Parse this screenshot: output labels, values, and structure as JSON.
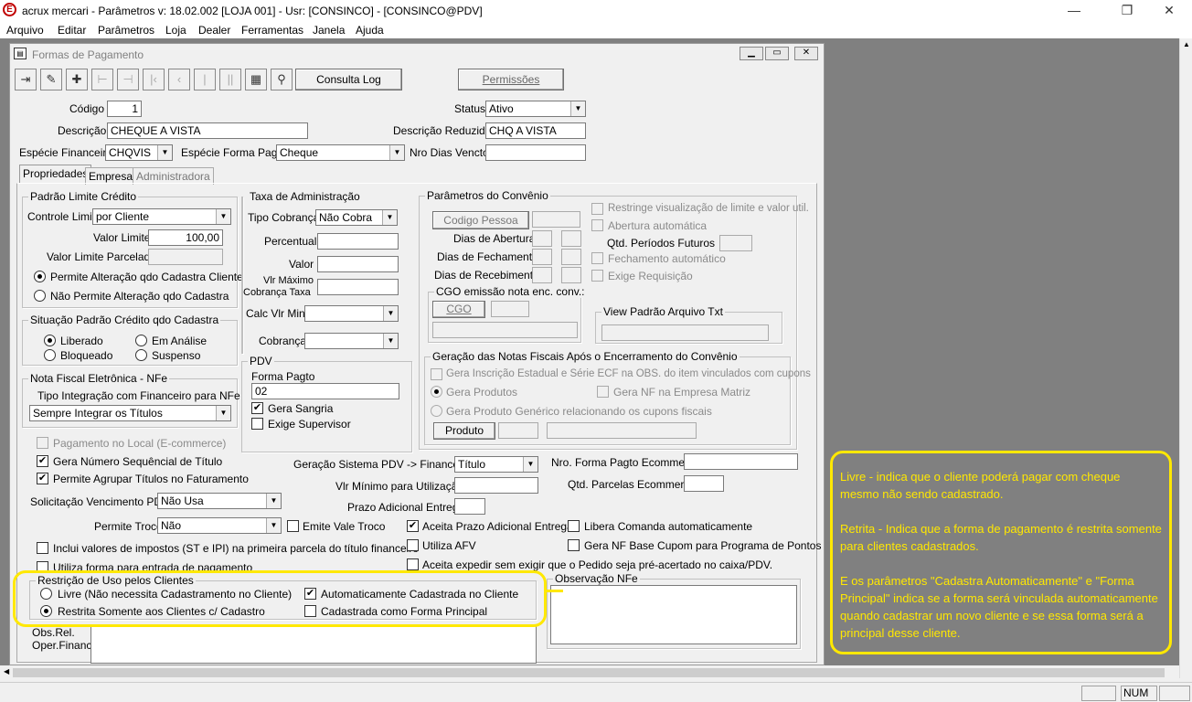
{
  "app": {
    "title": "acrux mercari - Parâmetros  v: 18.02.002  [LOJA 001] - Usr: [CONSINCO] - [CONSINCO@PDV]",
    "logo_letter": "E",
    "menu": [
      "Arquivo",
      "Editar",
      "Parâmetros",
      "Loja",
      "Dealer",
      "Ferramentas",
      "Janela",
      "Ajuda"
    ]
  },
  "window": {
    "title": "Formas de Pagamento",
    "consulta_log": "Consulta Log",
    "permissoes": "Permissões"
  },
  "header": {
    "codigo_label": "Código",
    "codigo_value": "1",
    "status_label": "Status",
    "status_value": "Ativo",
    "descricao_label": "Descrição",
    "descricao_value": "CHEQUE A VISTA",
    "descr_reduzida_label": "Descrição Reduzida",
    "descr_reduzida_value": "CHQ A VISTA",
    "especie_fin_label": "Espécie Financeira",
    "especie_fin_value": "CHQVIS",
    "especie_forma_label": "Espécie Forma Pagto",
    "especie_forma_value": "Cheque",
    "nro_dias_label": "Nro Dias Vencto",
    "nro_dias_value": ""
  },
  "tabs": [
    "Propriedades",
    "Empresas",
    "Administradora"
  ],
  "padrao_limite": {
    "title": "Padrão Limite Crédito",
    "controle_label": "Controle Limite",
    "controle_value": "por Cliente",
    "valor_limite_label": "Valor Limite",
    "valor_limite_value": "100,00",
    "valor_parcelado_label": "Valor Limite Parcelado",
    "radio1": "Permite Alteração qdo Cadastra Cliente",
    "radio2": "Não Permite Alteração qdo Cadastra"
  },
  "situacao": {
    "title": "Situação Padrão Crédito qdo Cadastra",
    "liberado": "Liberado",
    "em_analise": "Em Análise",
    "bloqueado": "Bloqueado",
    "suspenso": "Suspenso"
  },
  "nfe": {
    "title": "Nota Fiscal Eletrônica - NFe",
    "tipo_label": "Tipo Integração com Financeiro para NFe",
    "tipo_value": "Sempre Integrar os Títulos"
  },
  "taxa": {
    "title": "Taxa de Administração",
    "tipo_cobranca_label": "Tipo Cobrança",
    "tipo_cobranca_value": "Não Cobra",
    "percentual_label": "Percentual",
    "valor_label": "Valor",
    "vlr_max_label1": "Vlr Máximo",
    "vlr_max_label2": "Cobrança Taxa",
    "calc_label": "Calc Vlr Min",
    "cobranca_label": "Cobrança"
  },
  "pdv": {
    "title": "PDV",
    "forma_label": "Forma Pagto",
    "forma_value": "02",
    "gera_sangria": "Gera Sangria",
    "exige_supervisor": "Exige Supervisor"
  },
  "convenio": {
    "title": "Parâmetros do Convênio",
    "codigo_pessoa": "Codigo Pessoa",
    "dias_abertura": "Dias de Abertura",
    "dias_fechamento": "Dias de Fechamento",
    "dias_recebimento": "Dias de Recebimento",
    "restringe": "Restringe visualização de limite e valor util.",
    "abertura_auto": "Abertura automática",
    "qtd_periodos": "Qtd. Períodos Futuros",
    "fechamento_auto": "Fechamento automático",
    "exige_req": "Exige Requisição",
    "cgo_title": "CGO emissão nota enc. conv.:",
    "cgo_btn": "CGO",
    "view_title": "View Padrão Arquivo Txt"
  },
  "geracao": {
    "title": "Geração das Notas Fiscais Após o Encerramento do Convênio",
    "gera_inscricao": "Gera Inscrição Estadual e Série ECF na OBS. do item vinculados com cupons",
    "gera_produtos": "Gera Produtos",
    "gera_nf_matriz": "Gera NF na Empresa Matriz",
    "gera_generico": "Gera Produto Genérico relacionando os cupons fiscais",
    "produto_btn": "Produto"
  },
  "misc": {
    "pagamento_local": "Pagamento no Local (E-commerce)",
    "gera_numero": "Gera Número Sequêncial de Título",
    "permite_agrupar": "Permite Agrupar Títulos no Faturamento",
    "solicitacao_label": "Solicitação Vencimento PDV",
    "solicitacao_value": "Não Usa",
    "permite_troco_label": "Permite Troco",
    "permite_troco_value": "Não",
    "emite_vale": "Emite Vale Troco",
    "inclui_valores": "Inclui valores de impostos (ST e IPI) na primeira parcela do título financeiro",
    "utiliza_forma": "Utiliza forma para entrada de pagamento",
    "geracao_pdv_label": "Geração Sistema PDV -> Financeiro",
    "geracao_pdv_value": "Título",
    "vlr_minimo_label": "Vlr Mínimo para Utilização",
    "prazo_adicional_label": "Prazo Adicional Entrega",
    "nro_forma_ecom_label": "Nro. Forma Pagto Ecommerce",
    "qtd_parcelas_ecom_label": "Qtd. Parcelas Ecommerce",
    "aceita_prazo": "Aceita Prazo Adicional Entrega",
    "libera_comanda": "Libera Comanda automaticamente",
    "utiliza_afv": "Utiliza AFV",
    "gera_nf_base": "Gera NF Base Cupom para Programa de Pontos",
    "aceita_expedir": "Aceita expedir sem exigir que o Pedido seja pré-acertado no caixa/PDV."
  },
  "restricao": {
    "title": "Restrição de Uso pelos Clientes",
    "livre": "Livre (Não necessita Cadastramento no Cliente)",
    "restrita": "Restrita Somente aos Clientes c/ Cadastro",
    "auto_cadastrada": "Automaticamente Cadastrada no Cliente",
    "forma_principal": "Cadastrada como Forma Principal"
  },
  "obs": {
    "observacao_title": "Observação NFe",
    "obs_rel1": "Obs.Rel.",
    "obs_rel2": "Oper.Financ."
  },
  "statusbar": {
    "num": "NUM"
  },
  "annotation": {
    "p1": "Livre - indica que o cliente poderá pagar com cheque mesmo não sendo cadastrado.",
    "p2": "Retrita - Indica que a forma de pagamento é restrita somente para clientes cadastrados.",
    "p3": "E os parâmetros \"Cadastra Automaticamente\" e \"Forma Principal\" indica se a forma será vinculada automaticamente quando cadastrar um novo cliente e se essa forma será a principal desse cliente."
  },
  "colors": {
    "highlight": "#ffe800",
    "mdi_bg": "#808080"
  }
}
